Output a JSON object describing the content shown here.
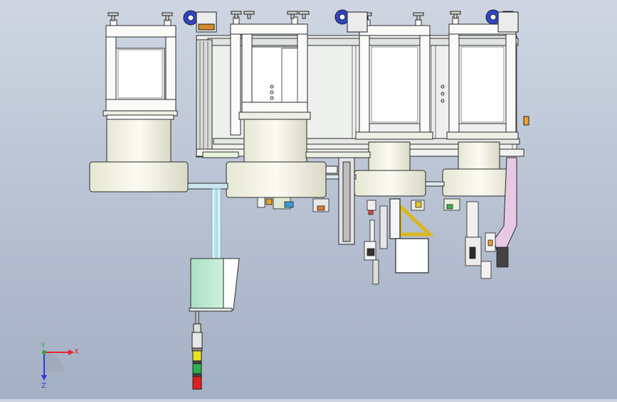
{
  "triad": {
    "x_label": "X",
    "y_label": "Y",
    "z_label": "Z",
    "x_color": "#e8242a",
    "y_color": "#2aa33a",
    "z_color": "#2a3fd8"
  },
  "colors": {
    "background_top": "#cfd6e2",
    "background_bottom": "#a4afc3",
    "frame": "#f7f8f6",
    "frame_edge": "#2b2b2b",
    "cylinder": "#f2f2e4",
    "hopper": "#bfe9d2",
    "rail_blue": "#b8e3f0",
    "pink_duct": "#e7c9e3",
    "roller_blue": "#2f46c6",
    "tower_red": "#e01d1d",
    "tower_yellow": "#e7e21d",
    "tower_green": "#2bb24a"
  }
}
